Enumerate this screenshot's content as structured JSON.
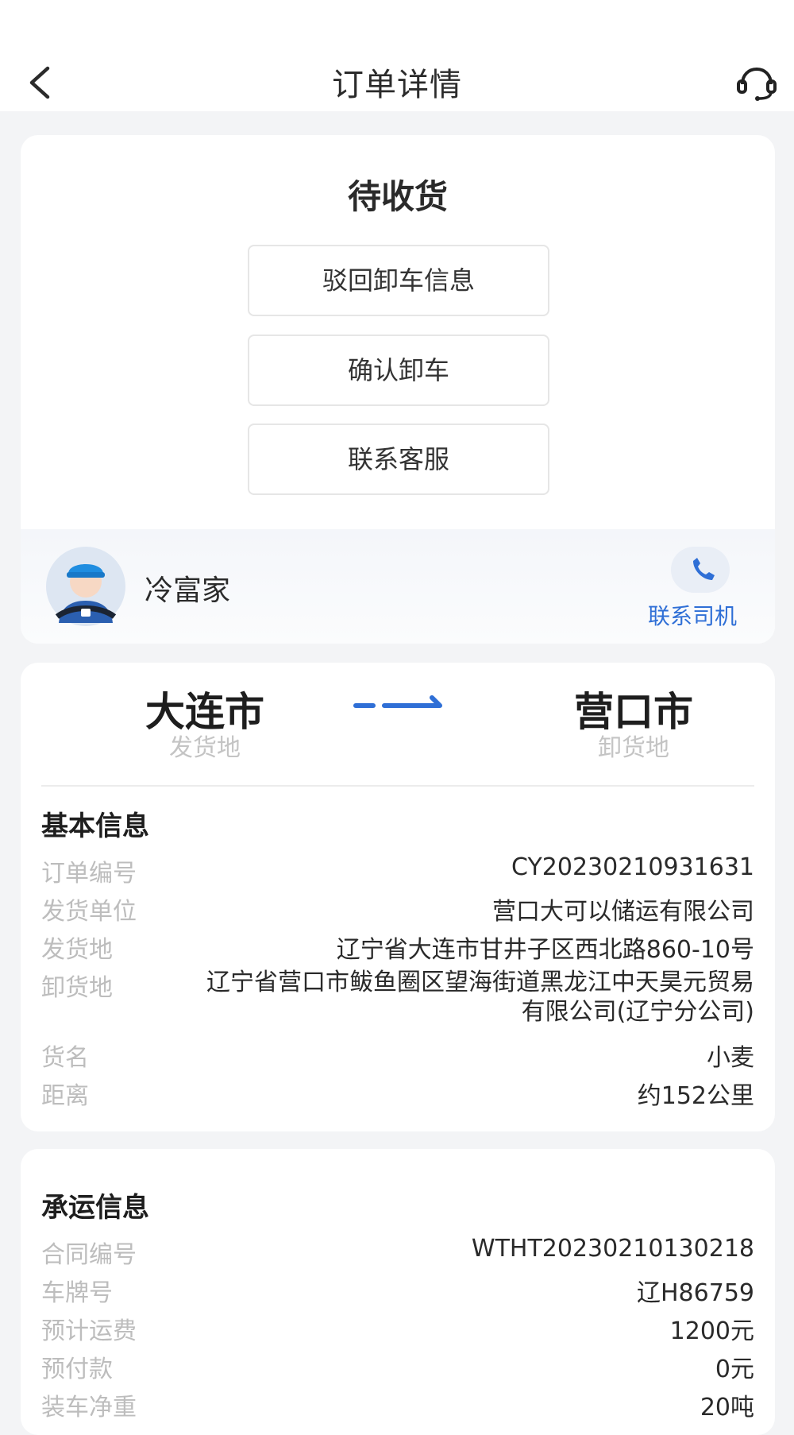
{
  "header": {
    "title": "订单详情",
    "back_icon": "chevron-left-icon",
    "service_icon": "headset-icon"
  },
  "status": {
    "title": "待收货",
    "buttons": [
      "驳回卸车信息",
      "确认卸车",
      "联系客服"
    ]
  },
  "driver": {
    "name": "冷富家",
    "avatar_icon": "driver-avatar",
    "phone_icon": "phone-icon",
    "contact_label": "联系司机"
  },
  "route": {
    "from_city": "大连市",
    "from_label": "发货地",
    "to_city": "营口市",
    "to_label": "卸货地",
    "arrow_icon": "route-arrow-icon",
    "accent_color": "#2f6fd6"
  },
  "basic_info": {
    "title": "基本信息",
    "rows": [
      {
        "label": "订单编号",
        "value": "CY20230210931631"
      },
      {
        "label": "发货单位",
        "value": "营口大可以储运有限公司"
      },
      {
        "label": "发货地",
        "value": "辽宁省大连市甘井子区西北路860-10号"
      },
      {
        "label": "卸货地",
        "value": "辽宁省营口市鲅鱼圈区望海街道黑龙江中天昊元贸易有限公司(辽宁分公司)"
      },
      {
        "label": "货名",
        "value": "小麦"
      },
      {
        "label": "距离",
        "value": "约152公里"
      }
    ]
  },
  "carrier_info": {
    "title": "承运信息",
    "rows": [
      {
        "label": "合同编号",
        "value": "WTHT20230210130218"
      },
      {
        "label": "车牌号",
        "value": "辽H86759"
      },
      {
        "label": "预计运费",
        "value": "1200元"
      },
      {
        "label": "预付款",
        "value": "0元"
      },
      {
        "label": "装车净重",
        "value": "20吨"
      }
    ]
  }
}
